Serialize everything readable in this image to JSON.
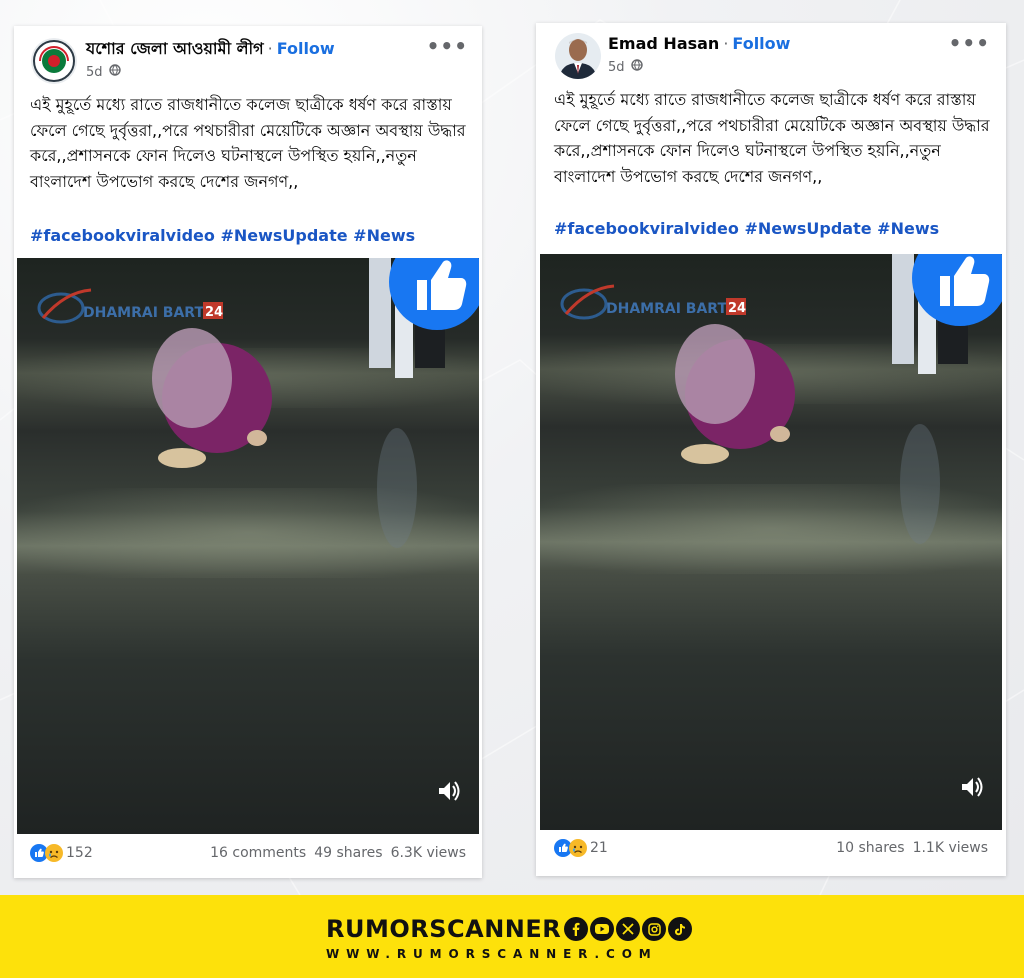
{
  "posts": [
    {
      "author": "যশোর জেলা আওয়ামী লীগ",
      "follow_label": "Follow",
      "separator": "·",
      "time": "5d",
      "more_label": "•••",
      "text": "এই মুহূর্তে মধ্যে রাতে রাজধানীতে কলেজ ছাত্রীকে ধর্ষণ করে রাস্তায় ফেলে গেছে দুর্বৃত্তরা,,পরে পথচারীরা মেয়েটিকে অজ্ঞান অবস্থায় উদ্ধার করে,,প্রশাসনকে ফোন দিলেও ঘটনাস্থলে উপস্থিত হয়নি,,নতুন বাংলাদেশ উপভোগ করছে দেশের জনগণ,,",
      "hashtags": "#facebookviralvideo #NewsUpdate #News",
      "watermark": "DHAMRAI BARTA",
      "watermark_num": "24",
      "reaction_count": "152",
      "comments": "16 comments",
      "shares": "49 shares",
      "views": "6.3K views"
    },
    {
      "author": "Emad Hasan",
      "follow_label": "Follow",
      "separator": "·",
      "time": "5d",
      "more_label": "•••",
      "text": "এই মুহূর্তে মধ্যে রাতে রাজধানীতে কলেজ ছাত্রীকে ধর্ষণ করে রাস্তায় ফেলে গেছে দুর্বৃত্তরা,,পরে পথচারীরা মেয়েটিকে অজ্ঞান অবস্থায় উদ্ধার করে,,প্রশাসনকে ফোন দিলেও ঘটনাস্থলে উপস্থিত হয়নি,,নতুন বাংলাদেশ উপভোগ করছে দেশের জনগণ,,",
      "hashtags": "#facebookviralvideo #NewsUpdate #News",
      "watermark": "DHAMRAI BARTA",
      "watermark_num": "24",
      "reaction_count": "21",
      "shares": "10 shares",
      "views": "1.1K views"
    }
  ],
  "footer": {
    "brand": "RUMORSCANNER",
    "website": "WWW.RUMORSCANNER.COM",
    "social_icons": [
      "facebook-icon",
      "youtube-icon",
      "x-icon",
      "instagram-icon",
      "tiktok-icon"
    ]
  },
  "colors": {
    "follow": "#1a6fe0",
    "hashtag": "#1a56c4",
    "footer_bg": "#fde10b",
    "like_blue": "#1877f2"
  }
}
